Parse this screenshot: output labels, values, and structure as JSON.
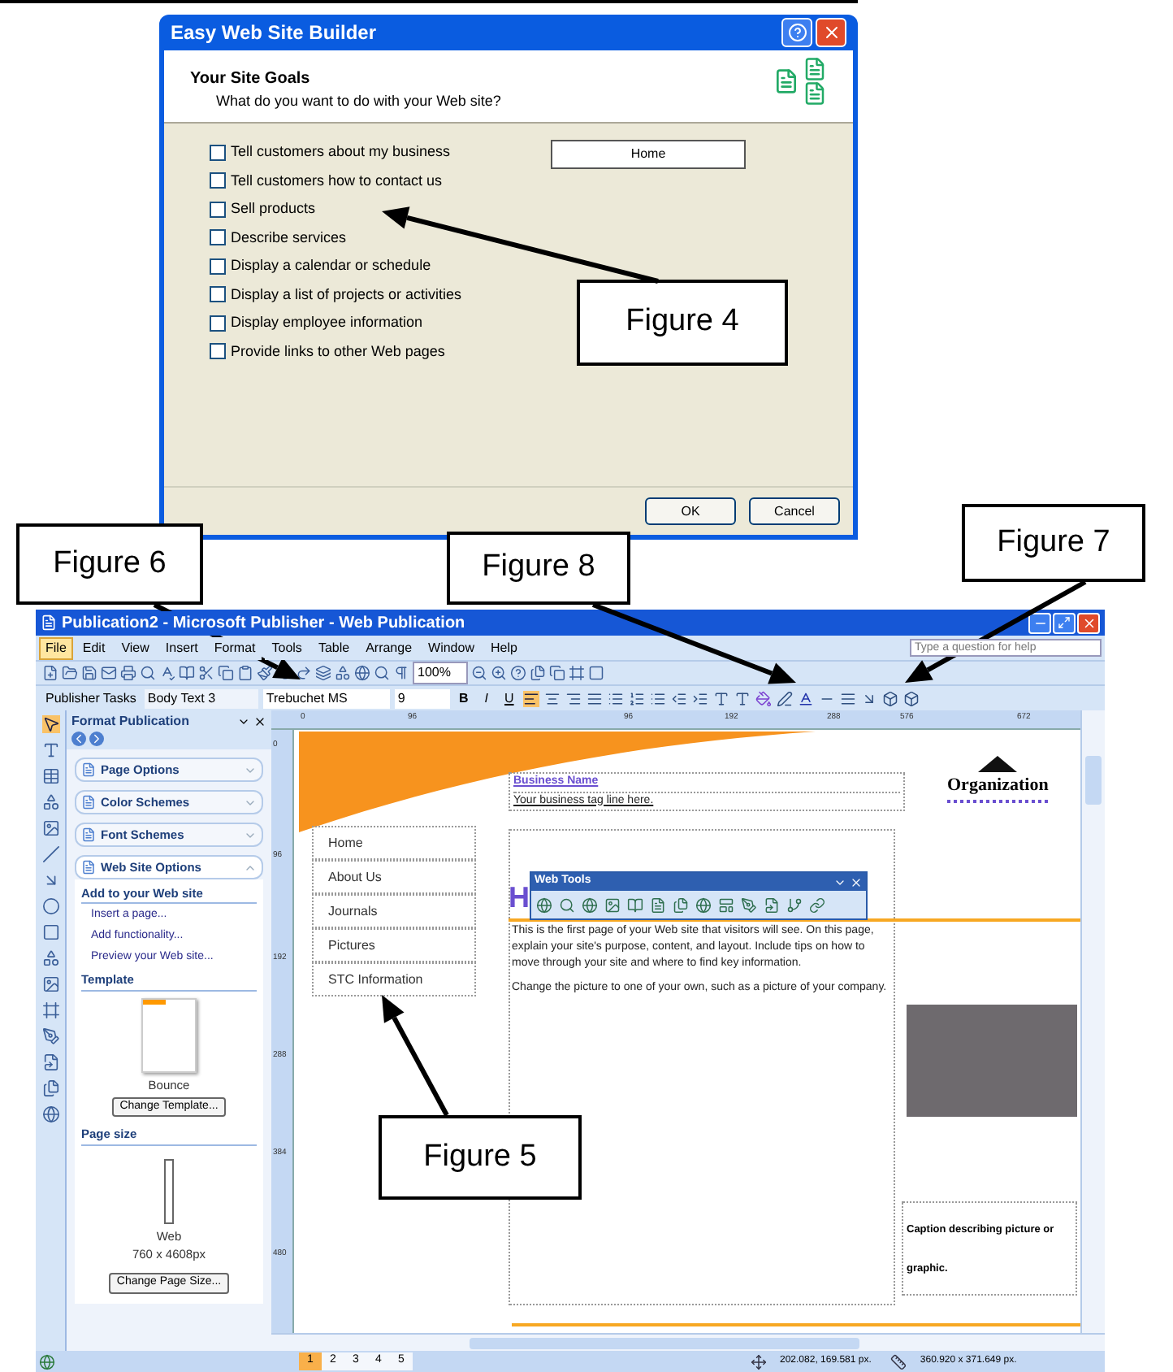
{
  "dialog": {
    "title": "Easy Web Site Builder",
    "heading": "Your Site Goals",
    "subheading": "What do you want to do with your Web site?",
    "goals": [
      {
        "label": "Tell customers about my business",
        "checked": false
      },
      {
        "label": "Tell customers how to contact us",
        "checked": false
      },
      {
        "label": "Sell products",
        "checked": false
      },
      {
        "label": "Describe services",
        "checked": false
      },
      {
        "label": "Display a calendar or schedule",
        "checked": false
      },
      {
        "label": "Display a list of projects or activities",
        "checked": false
      },
      {
        "label": "Display employee information",
        "checked": false
      },
      {
        "label": "Provide links to other Web pages",
        "checked": false
      }
    ],
    "preview_pages": [
      "Home"
    ],
    "buttons": [
      "OK",
      "Cancel"
    ]
  },
  "callouts": [
    {
      "label": "Figure 4"
    },
    {
      "label": "Figure 6"
    },
    {
      "label": "Figure 8"
    },
    {
      "label": "Figure 7"
    },
    {
      "label": "Figure 5"
    }
  ],
  "publisher": {
    "title": "Publication2 - Microsoft Publisher - Web Publication",
    "menu": [
      {
        "label": "File",
        "selected": true
      },
      {
        "label": "Edit",
        "selected": false
      },
      {
        "label": "View",
        "selected": false
      },
      {
        "label": "Insert",
        "selected": false
      },
      {
        "label": "Format",
        "selected": false
      },
      {
        "label": "Tools",
        "selected": false
      },
      {
        "label": "Table",
        "selected": false
      },
      {
        "label": "Arrange",
        "selected": false
      },
      {
        "label": "Window",
        "selected": false
      },
      {
        "label": "Help",
        "selected": false
      }
    ],
    "help_field": {
      "placeholder": "Type a question for help"
    },
    "zoom": "100%",
    "format_bar": {
      "tasks_button": "Publisher Tasks",
      "style": "Body Text 3",
      "font": "Trebuchet MS",
      "size": "9",
      "text_buttons": [
        "B",
        "I",
        "U"
      ]
    },
    "task_pane": {
      "title": "Format Publication",
      "sections": [
        {
          "label": "Page Options",
          "expanded": false
        },
        {
          "label": "Color Schemes",
          "expanded": false
        },
        {
          "label": "Font Schemes",
          "expanded": false
        },
        {
          "label": "Web Site Options",
          "expanded": true
        }
      ],
      "add_heading": "Add to your Web site",
      "links": [
        "Insert a page...",
        "Add functionality...",
        "Preview your Web site..."
      ],
      "template_heading": "Template",
      "template_name": "Bounce",
      "template_button": "Change Template...",
      "size_heading": "Page size",
      "size_name": "Web",
      "size_dims": "760 x 4608px",
      "size_button": "Change Page Size..."
    },
    "ruler_h": [
      "0",
      "96",
      "96",
      "192",
      "288",
      "576",
      "672"
    ],
    "ruler_v": [
      "0",
      "96",
      "192",
      "288",
      "384",
      "480"
    ],
    "page": {
      "business_name": "Business Name",
      "tagline": "Your business tag line here.",
      "logo_text": "Organization",
      "nav": [
        "Home",
        "About Us",
        "Journals",
        "Pictures",
        "STC Information"
      ],
      "heading": "H",
      "paragraphs": [
        "This is the first page of your Web site that visitors will see. On this page, explain your site's purpose, content, and layout. Include tips on how to move through your site and where to find key information.",
        "Change the picture to one of your own, such as a picture of your company."
      ],
      "caption": "Caption describing picture or graphic."
    },
    "web_tools": {
      "title": "Web Tools"
    },
    "page_tabs": [
      {
        "label": "1",
        "selected": true
      },
      {
        "label": "2",
        "selected": false
      },
      {
        "label": "3",
        "selected": false
      },
      {
        "label": "4",
        "selected": false
      },
      {
        "label": "5",
        "selected": false
      }
    ],
    "status": {
      "position": "202.082, 169.581 px.",
      "size": "360.920 x 371.649 px."
    }
  }
}
